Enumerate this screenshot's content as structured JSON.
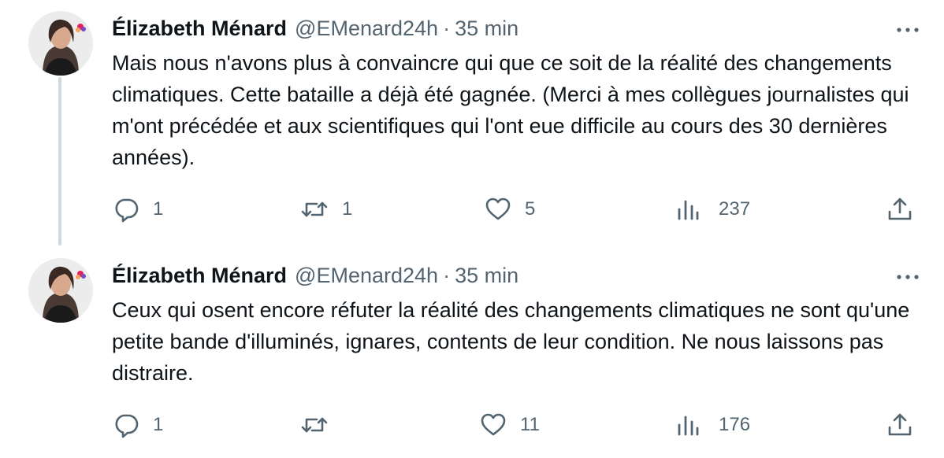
{
  "tweets": [
    {
      "author_name": "Élizabeth Ménard",
      "handle": "@EMenard24h",
      "separator": "·",
      "time": "35 min",
      "text": "Mais nous n'avons plus à convaincre qui que ce soit de la réalité des changements climatiques. Cette bataille a déjà été gagnée. (Merci à mes collègues journalistes qui m'ont précédée et aux scientifiques qui l'ont eue difficile au cours des 30 dernières années).",
      "replies": "1",
      "retweets": "1",
      "likes": "5",
      "views": "237"
    },
    {
      "author_name": "Élizabeth Ménard",
      "handle": "@EMenard24h",
      "separator": "·",
      "time": "35 min",
      "text": "Ceux qui osent encore réfuter la réalité des changements climatiques ne sont qu'une petite bande d'illuminés, ignares, contents de leur condition. Ne nous laissons pas distraire.",
      "replies": "1",
      "retweets": "",
      "likes": "11",
      "views": "176"
    }
  ],
  "colors": {
    "text": "#0f1419",
    "secondary": "#536471",
    "thread_line": "#cfd9de"
  },
  "icons": [
    "reply-icon",
    "retweet-icon",
    "like-icon",
    "views-icon",
    "share-icon",
    "more-icon"
  ]
}
